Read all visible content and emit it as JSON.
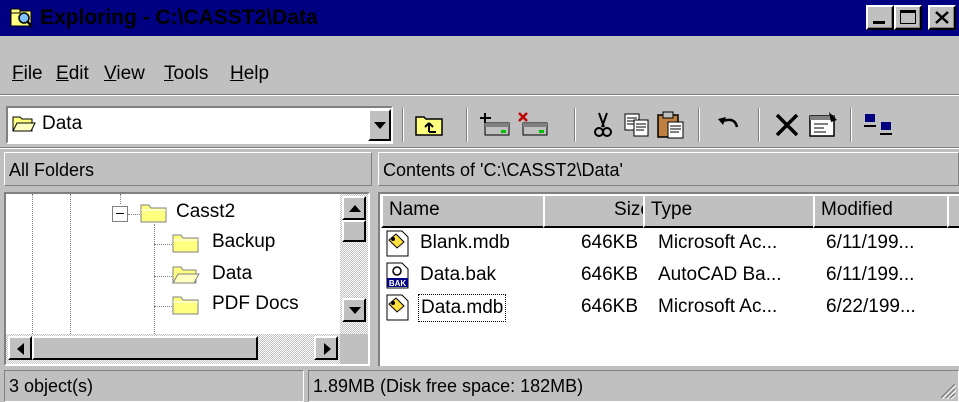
{
  "window": {
    "title": "Exploring - C:\\CASST2\\Data"
  },
  "menu": [
    {
      "label": "File",
      "accel": "F",
      "rest": "ile"
    },
    {
      "label": "Edit",
      "accel": "E",
      "rest": "dit"
    },
    {
      "label": "View",
      "accel": "V",
      "rest": "iew"
    },
    {
      "label": "Tools",
      "accel": "T",
      "rest": "ools"
    },
    {
      "label": "Help",
      "accel": "H",
      "rest": "elp"
    }
  ],
  "address": {
    "value": "Data",
    "icon": "open-folder-icon"
  },
  "toolbar": {
    "buttons": [
      "up-one-level",
      "map-network-drive",
      "disconnect-network-drive",
      "cut",
      "copy",
      "paste",
      "undo",
      "delete",
      "properties",
      "large-icons"
    ]
  },
  "left_panel": {
    "header": "All Folders",
    "tree": [
      {
        "label": "Casst2",
        "expander": "−"
      },
      {
        "label": "Backup"
      },
      {
        "label": "Data"
      },
      {
        "label": "PDF Docs"
      }
    ]
  },
  "right_panel": {
    "header": "Contents of 'C:\\CASST2\\Data'",
    "columns": [
      "Name",
      "Size",
      "Type",
      "Modified"
    ],
    "rows": [
      {
        "name": "Blank.mdb",
        "size": "646KB",
        "type": "Microsoft Ac...",
        "modified": "6/11/199...",
        "icon": "access-db-icon"
      },
      {
        "name": "Data.bak",
        "size": "646KB",
        "type": "AutoCAD Ba...",
        "modified": "6/11/199...",
        "icon": "bak-file-icon"
      },
      {
        "name": "Data.mdb",
        "size": "646KB",
        "type": "Microsoft Ac...",
        "modified": "6/22/199...",
        "icon": "access-db-icon"
      }
    ]
  },
  "status": {
    "objects": "3 object(s)",
    "disk": "1.89MB (Disk free space: 182MB)"
  },
  "colors": {
    "titlebar": "#000080",
    "face": "#c0c0c0",
    "folder": "#ffff80"
  }
}
